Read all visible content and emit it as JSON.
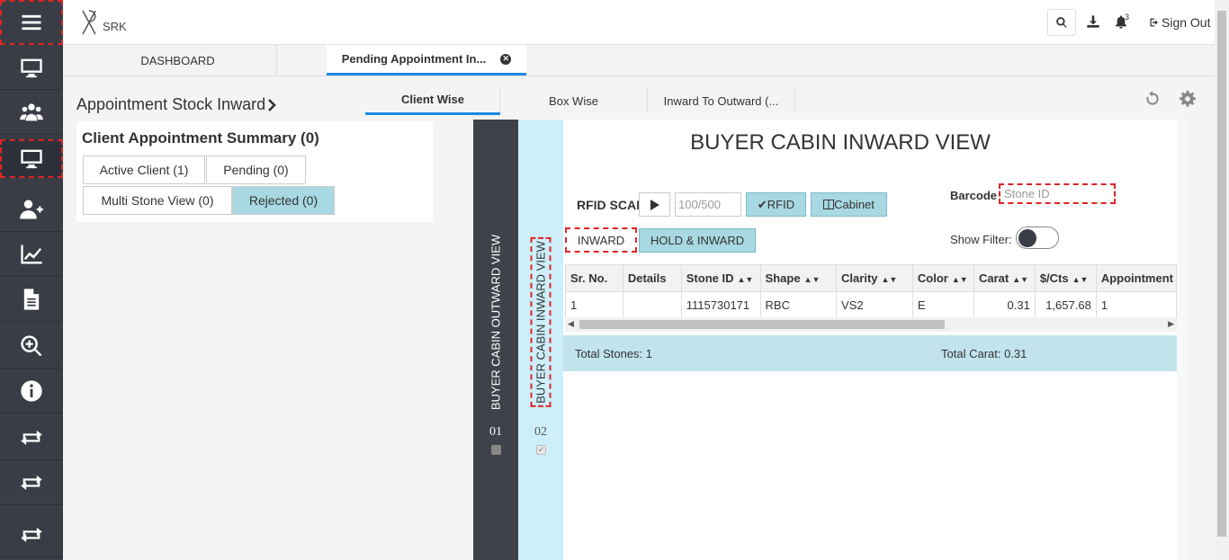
{
  "sidebar": {
    "items": [
      {
        "icon": "hamburger-menu-icon"
      },
      {
        "icon": "monitor-icon"
      },
      {
        "icon": "users-group-icon"
      },
      {
        "icon": "monitor-icon"
      },
      {
        "icon": "user-plus-icon"
      },
      {
        "icon": "line-chart-icon"
      },
      {
        "icon": "document-icon"
      },
      {
        "icon": "zoom-in-icon"
      },
      {
        "icon": "info-icon"
      },
      {
        "icon": "transfer-arrows-icon"
      },
      {
        "icon": "transfer-arrows-icon"
      },
      {
        "icon": "transfer-arrows-icon"
      }
    ]
  },
  "topbar": {
    "logo_text": "SRK",
    "bell_count": "3",
    "signout_label": "Sign Out"
  },
  "tabs": {
    "dashboard": "DASHBOARD",
    "pending": "Pending Appointment In..."
  },
  "page": {
    "title": "Appointment Stock Inward",
    "subtabs": {
      "client_wise": "Client Wise",
      "box_wise": "Box Wise",
      "inward_to_outward": "Inward To Outward (..."
    }
  },
  "left_panel": {
    "title": "Client Appointment Summary (0)",
    "active_client": "Active Client (1)",
    "pending": "Pending (0)",
    "multi_stone": "Multi Stone View (0)",
    "rejected": "Rejected (0)"
  },
  "vertical_panels": {
    "outward_label": "BUYER CABIN OUTWARD VIEW",
    "outward_num": "01",
    "inward_label": "BUYER CABIN INWARD VIEW",
    "inward_num": "02"
  },
  "content": {
    "title": "BUYER CABIN INWARD VIEW",
    "rfid_label": "RFID SCAN",
    "count_placeholder": "100/500",
    "rfid_btn": "RFID",
    "cabinet_btn": "Cabinet",
    "barcode_label": "Barcode",
    "barcode_placeholder": "Stone ID",
    "inward_btn": "INWARD",
    "hold_inward_btn": "HOLD & INWARD",
    "show_filter_label": "Show Filter:",
    "show_filter_on": false
  },
  "table": {
    "headers": [
      "Sr. No.",
      "Details",
      "Stone ID",
      "Shape",
      "Clarity",
      "Color",
      "Carat",
      "$/Cts",
      "Appointment"
    ],
    "rows": [
      [
        "1",
        "",
        "1115730171",
        "RBC",
        "VS2",
        "E",
        "0.31",
        "1,657.68",
        "1"
      ]
    ]
  },
  "summary": {
    "total_stones": "Total Stones: 1",
    "total_carat": "Total Carat: 0.31"
  },
  "colors": {
    "sidebar_bg": "#3a3d46",
    "accent_blue": "#1e88e5",
    "button_teal": "#a8d8e2",
    "summary_bg": "#c0e3ec",
    "inward_panel_bg": "#cdeffa"
  }
}
